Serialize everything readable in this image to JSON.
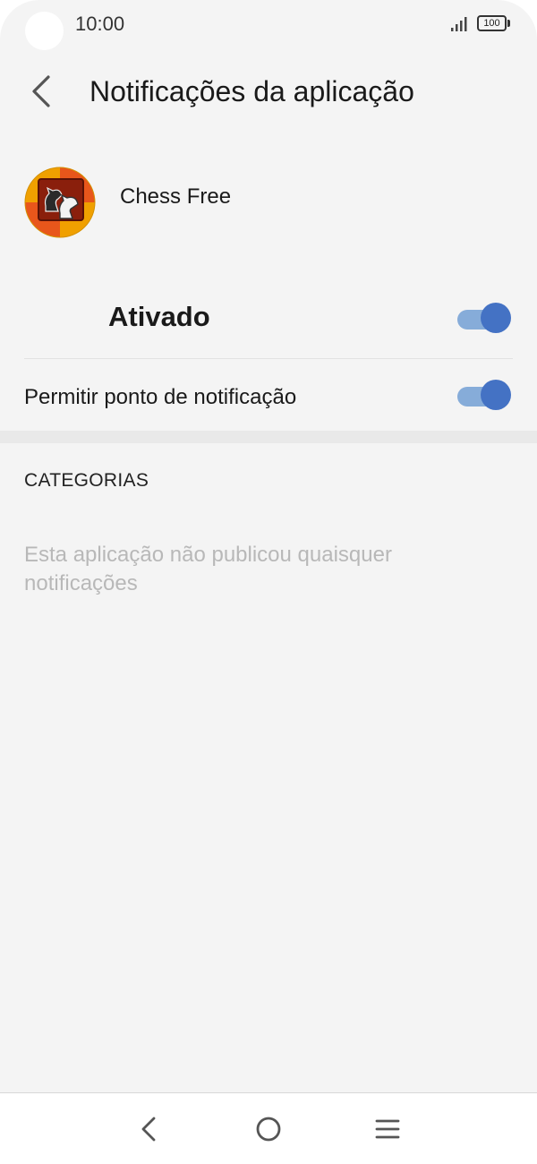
{
  "status_bar": {
    "time": "10:00",
    "battery_level": "100",
    "icons": [
      "signal-icon",
      "battery-icon"
    ]
  },
  "header": {
    "title": "Notificações da aplicação",
    "back_icon": "chevron-left-icon"
  },
  "app": {
    "name": "Chess Free",
    "icon": "chess-knight-app-icon"
  },
  "settings": {
    "main_toggle": {
      "label": "Ativado",
      "state": "on"
    },
    "dot_toggle": {
      "label": "Permitir ponto de notificação",
      "state": "on"
    }
  },
  "categories": {
    "header": "CATEGORIAS",
    "empty_message": "Esta aplicação não publicou quaisquer notificações"
  },
  "nav_bar": {
    "icons": [
      "back-icon",
      "home-icon",
      "menu-icon"
    ]
  },
  "colors": {
    "background": "#f4f4f4",
    "toggle_thumb": "#4472c4",
    "toggle_track": "#86acd9",
    "muted_text": "#b8b8b8"
  }
}
